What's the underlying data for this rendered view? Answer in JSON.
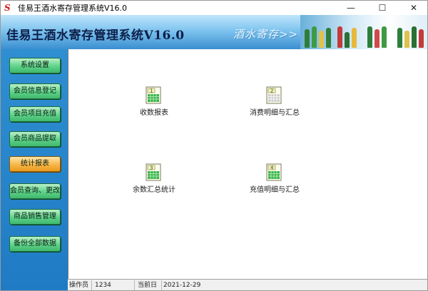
{
  "window": {
    "title": "佳易王酒水寄存管理系统V16.0",
    "icon": "app-logo-icon",
    "controls": {
      "minimize": "—",
      "maximize": "☐",
      "close": "✕"
    }
  },
  "banner": {
    "title": "佳易王酒水寄存管理系统V16.0",
    "slogan": "酒水寄存>>"
  },
  "sidebar": {
    "items": [
      {
        "label": "系统设置",
        "active": false
      },
      {
        "label": "会员信息登记",
        "active": false
      },
      {
        "label": "会员项目充值",
        "active": false
      },
      {
        "label": "会员商品提取",
        "active": false
      },
      {
        "label": "统计报表",
        "active": true
      },
      {
        "label": "会员查询、更改",
        "active": false
      },
      {
        "label": "商品销售管理",
        "active": false
      },
      {
        "label": "备份全部数据",
        "active": false
      }
    ]
  },
  "reports": [
    {
      "number": "1",
      "label": "收数报表"
    },
    {
      "number": "2",
      "label": "消费明细与汇总"
    },
    {
      "number": "3",
      "label": "余数汇总统计"
    },
    {
      "number": "4",
      "label": "充值明细与汇总"
    }
  ],
  "statusbar": {
    "operator_label": "操作员",
    "operator_value": "1234",
    "date_label": "当前日期",
    "date_value": "2021-12-29"
  },
  "colors": {
    "sidebar": "#1f7bc4",
    "nav_button": "#5fd28a",
    "nav_active": "#f6b242",
    "banner": "#7fc4ef"
  }
}
